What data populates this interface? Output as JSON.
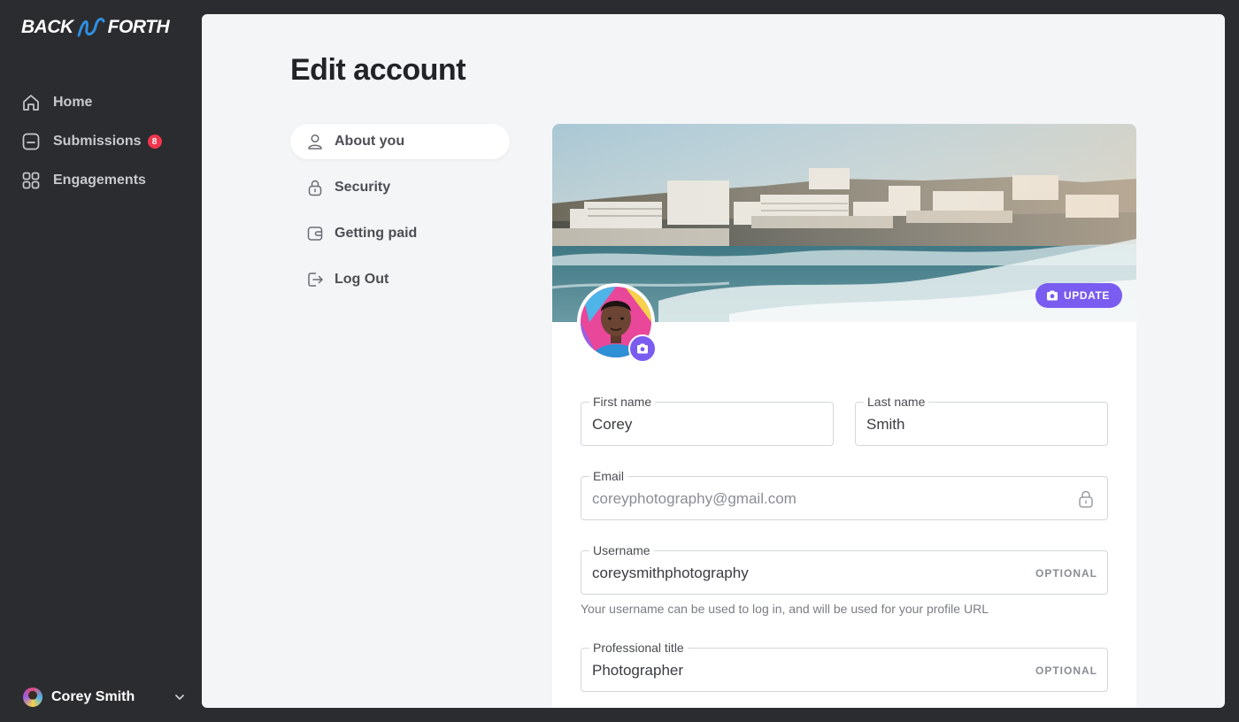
{
  "brand": {
    "left": "BACK",
    "right": "FORTH"
  },
  "sidebar": {
    "items": [
      {
        "label": "Home",
        "icon": "home-icon"
      },
      {
        "label": "Submissions",
        "icon": "inbox-icon",
        "badge": "8"
      },
      {
        "label": "Engagements",
        "icon": "grid-icon"
      }
    ],
    "user": {
      "name": "Corey Smith"
    }
  },
  "page": {
    "title": "Edit account"
  },
  "subnav": {
    "items": [
      {
        "label": "About you",
        "icon": "user-icon",
        "active": true
      },
      {
        "label": "Security",
        "icon": "lock-icon"
      },
      {
        "label": "Getting paid",
        "icon": "wallet-icon"
      },
      {
        "label": "Log Out",
        "icon": "logout-icon"
      }
    ]
  },
  "profile": {
    "update_label": "UPDATE",
    "first_name": {
      "label": "First name",
      "value": "Corey"
    },
    "last_name": {
      "label": "Last name",
      "value": "Smith"
    },
    "email": {
      "label": "Email",
      "value": "coreyphotography@gmail.com",
      "locked": true
    },
    "username": {
      "label": "Username",
      "value": "coreysmithphotography",
      "tag": "OPTIONAL",
      "hint": "Your username can be used to log in, and will be used for your profile URL"
    },
    "title": {
      "label": "Professional title",
      "value": "Photographer",
      "tag": "OPTIONAL"
    }
  },
  "colors": {
    "accent": "#7a5cf0",
    "badge": "#f0364f",
    "sidebar_bg": "#2b2c2f",
    "main_bg": "#f4f5f7",
    "logo_swoosh": "#2f8fe0"
  }
}
